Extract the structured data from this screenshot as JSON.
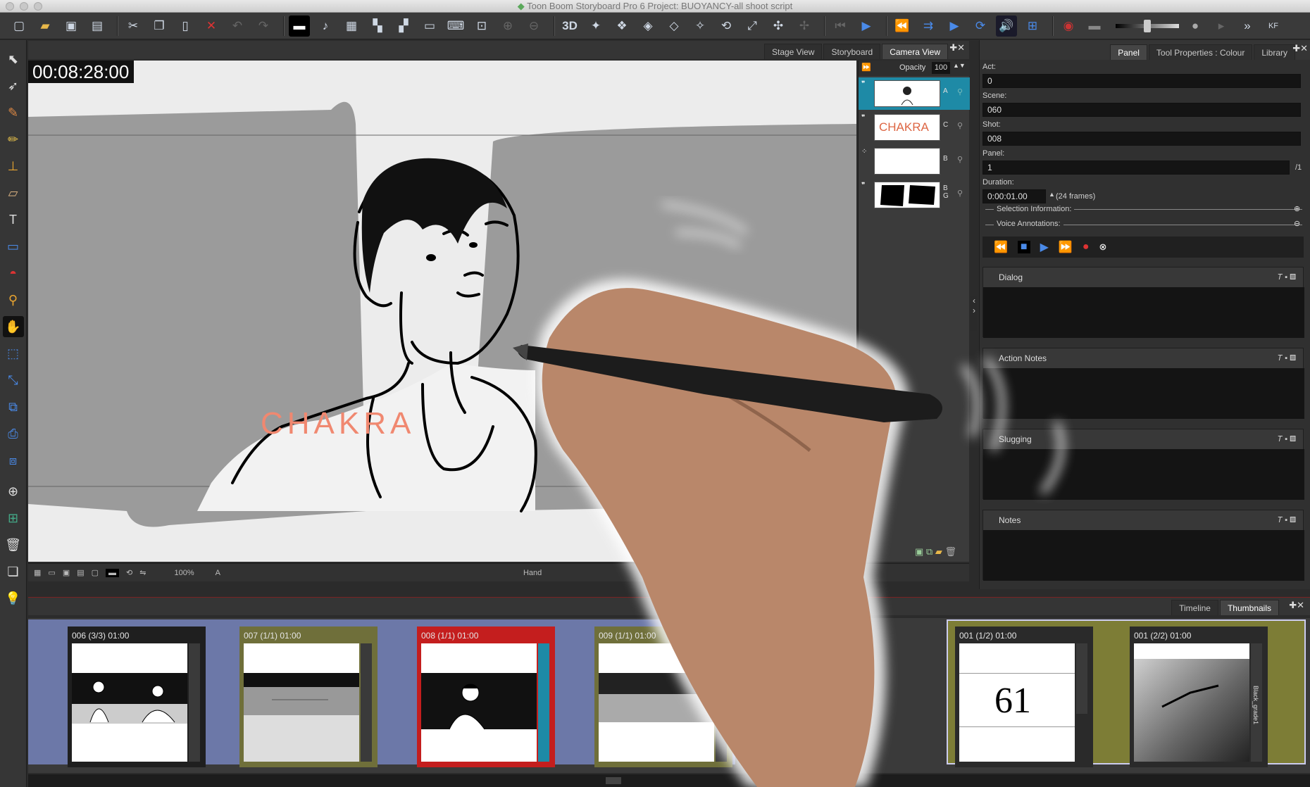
{
  "window": {
    "title": "Toon Boom Storyboard Pro 6 Project: BUOYANCY-all shoot script"
  },
  "view_tabs": [
    "Stage View",
    "Storyboard",
    "Camera View"
  ],
  "timecode": "00:08:28:00",
  "layers": {
    "opacity_label": "Opacity",
    "opacity_value": "100",
    "items": [
      {
        "name": "A"
      },
      {
        "name": "C"
      },
      {
        "name": "B"
      },
      {
        "name": "BG"
      }
    ]
  },
  "canvas_bar": {
    "zoom": "100%",
    "layer": "A",
    "tool": "Hand"
  },
  "drawing_text": "CHAKRA",
  "right_tabs": [
    "Panel",
    "Tool Properties : Colour",
    "Library"
  ],
  "panel_props": {
    "act_label": "Act:",
    "act": "0",
    "scene_label": "Scene:",
    "scene": "060",
    "shot_label": "Shot:",
    "shot": "008",
    "panel_label": "Panel:",
    "panel": "1",
    "panel_total": "/1",
    "duration_label": "Duration:",
    "duration": "0:00:01.00",
    "frames": "(24 frames)",
    "selection_info": "Selection Information:",
    "voice_annotations": "Voice Annotations:"
  },
  "sections": [
    "Dialog",
    "Action Notes",
    "Slugging",
    "Notes"
  ],
  "bottom_tabs": [
    "Timeline",
    "Thumbnails"
  ],
  "thumbnails": [
    {
      "label": "006 (3/3) 01:00"
    },
    {
      "label": "007 (1/1) 01:00"
    },
    {
      "label": "008 (1/1) 01:00"
    },
    {
      "label": "009 (1/1) 01:00"
    },
    {
      "label": "001 (1/2) 01:00"
    },
    {
      "label": "001 (2/2) 01:00"
    }
  ],
  "thumb_text_61": "61",
  "thumb_side_label": "Black_grade1",
  "colors": {
    "accent_teal": "#1e8aa6",
    "selected_panel": "#c41e1e",
    "strip_blue": "#6c78a8",
    "strip_olive": "#7d7d36"
  }
}
